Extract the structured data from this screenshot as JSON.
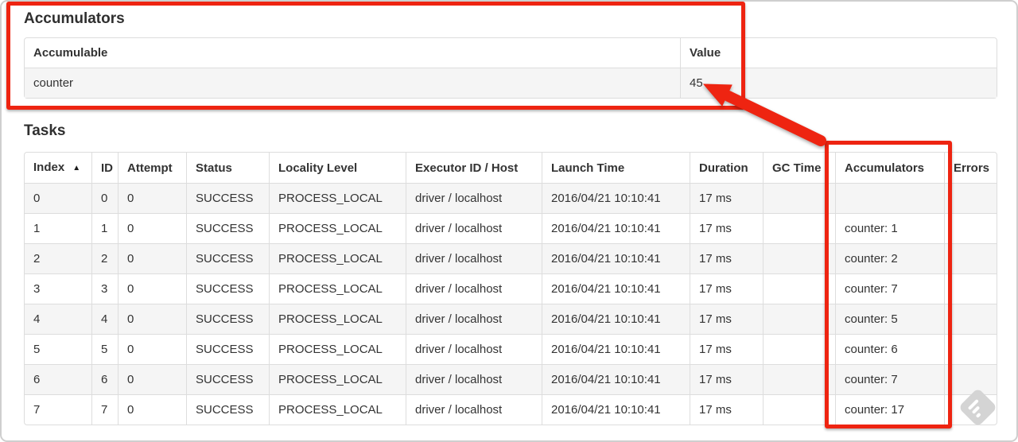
{
  "colors": {
    "annotation_red": "#ee2411",
    "table_border": "#dddddd",
    "stripe_bg": "#f5f5f5",
    "text": "#333333"
  },
  "icons": {
    "sort_ascending": "▲",
    "watermark": "gray-diamond-badge"
  },
  "accumulators": {
    "title": "Accumulators",
    "headers": [
      "Accumulable",
      "Value"
    ],
    "rows": [
      {
        "accumulable": "counter",
        "value": "45"
      }
    ]
  },
  "tasks": {
    "title": "Tasks",
    "table": {
      "columns": [
        {
          "key": "index",
          "label": "Index",
          "sorted": true
        },
        {
          "key": "id",
          "label": "ID"
        },
        {
          "key": "attempt",
          "label": "Attempt"
        },
        {
          "key": "status",
          "label": "Status"
        },
        {
          "key": "locality",
          "label": "Locality Level"
        },
        {
          "key": "executor",
          "label": "Executor ID / Host"
        },
        {
          "key": "launch",
          "label": "Launch Time"
        },
        {
          "key": "duration",
          "label": "Duration"
        },
        {
          "key": "gc",
          "label": "GC Time"
        },
        {
          "key": "accumulators",
          "label": "Accumulators"
        },
        {
          "key": "errors",
          "label": "Errors"
        }
      ],
      "rows": [
        {
          "index": "0",
          "id": "0",
          "attempt": "0",
          "status": "SUCCESS",
          "locality": "PROCESS_LOCAL",
          "executor": "driver / localhost",
          "launch": "2016/04/21 10:10:41",
          "duration": "17 ms",
          "gc": "",
          "accumulators": "",
          "errors": ""
        },
        {
          "index": "1",
          "id": "1",
          "attempt": "0",
          "status": "SUCCESS",
          "locality": "PROCESS_LOCAL",
          "executor": "driver / localhost",
          "launch": "2016/04/21 10:10:41",
          "duration": "17 ms",
          "gc": "",
          "accumulators": "counter: 1",
          "errors": ""
        },
        {
          "index": "2",
          "id": "2",
          "attempt": "0",
          "status": "SUCCESS",
          "locality": "PROCESS_LOCAL",
          "executor": "driver / localhost",
          "launch": "2016/04/21 10:10:41",
          "duration": "17 ms",
          "gc": "",
          "accumulators": "counter: 2",
          "errors": ""
        },
        {
          "index": "3",
          "id": "3",
          "attempt": "0",
          "status": "SUCCESS",
          "locality": "PROCESS_LOCAL",
          "executor": "driver / localhost",
          "launch": "2016/04/21 10:10:41",
          "duration": "17 ms",
          "gc": "",
          "accumulators": "counter: 7",
          "errors": ""
        },
        {
          "index": "4",
          "id": "4",
          "attempt": "0",
          "status": "SUCCESS",
          "locality": "PROCESS_LOCAL",
          "executor": "driver / localhost",
          "launch": "2016/04/21 10:10:41",
          "duration": "17 ms",
          "gc": "",
          "accumulators": "counter: 5",
          "errors": ""
        },
        {
          "index": "5",
          "id": "5",
          "attempt": "0",
          "status": "SUCCESS",
          "locality": "PROCESS_LOCAL",
          "executor": "driver / localhost",
          "launch": "2016/04/21 10:10:41",
          "duration": "17 ms",
          "gc": "",
          "accumulators": "counter: 6",
          "errors": ""
        },
        {
          "index": "6",
          "id": "6",
          "attempt": "0",
          "status": "SUCCESS",
          "locality": "PROCESS_LOCAL",
          "executor": "driver / localhost",
          "launch": "2016/04/21 10:10:41",
          "duration": "17 ms",
          "gc": "",
          "accumulators": "counter: 7",
          "errors": ""
        },
        {
          "index": "7",
          "id": "7",
          "attempt": "0",
          "status": "SUCCESS",
          "locality": "PROCESS_LOCAL",
          "executor": "driver / localhost",
          "launch": "2016/04/21 10:10:41",
          "duration": "17 ms",
          "gc": "",
          "accumulators": "counter: 17",
          "errors": ""
        }
      ]
    }
  }
}
